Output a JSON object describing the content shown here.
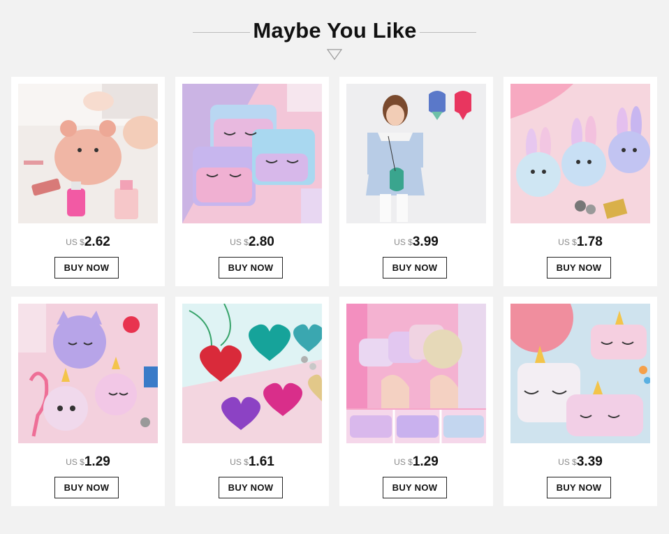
{
  "section": {
    "title": "Maybe You Like"
  },
  "products": [
    {
      "currency": "US $",
      "price": "2.62",
      "button": "BUY NOW"
    },
    {
      "currency": "US $",
      "price": "2.80",
      "button": "BUY NOW"
    },
    {
      "currency": "US $",
      "price": "3.99",
      "button": "BUY NOW"
    },
    {
      "currency": "US $",
      "price": "1.78",
      "button": "BUY NOW"
    },
    {
      "currency": "US $",
      "price": "1.29",
      "button": "BUY NOW"
    },
    {
      "currency": "US $",
      "price": "1.61",
      "button": "BUY NOW"
    },
    {
      "currency": "US $",
      "price": "1.29",
      "button": "BUY NOW"
    },
    {
      "currency": "US $",
      "price": "3.39",
      "button": "BUY NOW"
    }
  ],
  "colors": {
    "background": "#f2f2f2",
    "card": "#ffffff",
    "text": "#111111",
    "currency": "#888888"
  }
}
